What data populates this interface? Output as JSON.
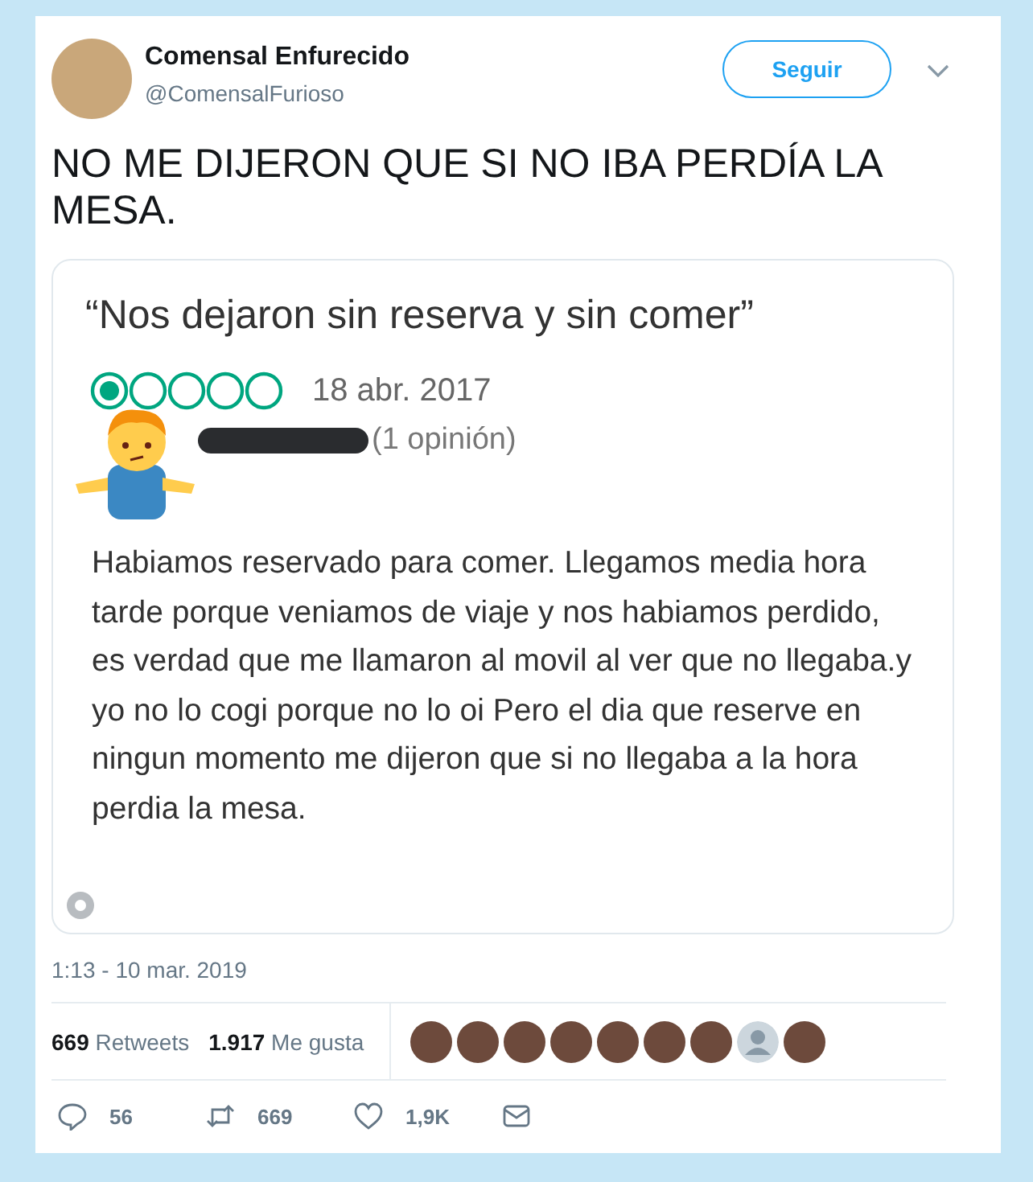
{
  "author": {
    "name": "Comensal Enfurecido",
    "handle": "@ComensalFurioso"
  },
  "follow_button": "Seguir",
  "tweet_text": "NO ME DIJERON QUE SI NO IBA PERDÍA LA MESA.",
  "review": {
    "title": "“Nos dejaron sin reserva y sin comer”",
    "stars": 1,
    "date": "18 abr. 2017",
    "reviewer_count": "(1 opinión)",
    "body": "Habiamos reservado para comer. Llegamos media hora tarde porque veniamos de viaje y nos habiamos perdido,  es verdad que me llamaron al movil al ver que no llegaba.y yo no lo cogi porque no lo oi Pero el dia que reserve en ningun momento me dijeron que si no llegaba a la hora perdia la mesa."
  },
  "timestamp": "1:13 - 10 mar. 2019",
  "stats": [
    {
      "count": "669",
      "label": "Retweets"
    },
    {
      "count": "1.917",
      "label": "Me gusta"
    }
  ],
  "likers": [
    {
      "kind": "photo"
    },
    {
      "kind": "photo"
    },
    {
      "kind": "photo"
    },
    {
      "kind": "photo"
    },
    {
      "kind": "photo"
    },
    {
      "kind": "photo"
    },
    {
      "kind": "photo"
    },
    {
      "kind": "default"
    },
    {
      "kind": "photo"
    }
  ],
  "actions": [
    {
      "kind": "reply",
      "count": "56"
    },
    {
      "kind": "retweet",
      "count": "669"
    },
    {
      "kind": "like",
      "count": "1,9K"
    },
    {
      "kind": "message"
    }
  ]
}
